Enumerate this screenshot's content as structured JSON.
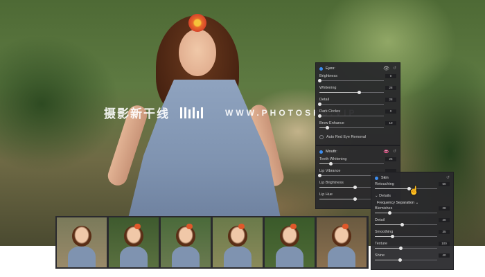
{
  "watermark": {
    "cn_text": "摄影新干线",
    "site": "WWW.PHOTOSKS.VIP"
  },
  "eyes_panel": {
    "title": "Eyes",
    "sliders": [
      {
        "label": "Brightness",
        "value": "0",
        "pct": 0
      },
      {
        "label": "Whitening",
        "value": "28",
        "pct": 0.62
      },
      {
        "label": "Detail",
        "value": "28",
        "pct": 0
      },
      {
        "label": "Dark Circles",
        "value": "0",
        "pct": 0
      },
      {
        "label": "Brow Enhance",
        "value": "10",
        "pct": 0.12
      }
    ],
    "checkbox": "Auto Red Eye Removal"
  },
  "mouth_panel": {
    "title": "Mouth",
    "sliders": [
      {
        "label": "Teeth Whitening",
        "value": "26",
        "pct": 0.18
      },
      {
        "label": "Lip Vibrance",
        "value": "",
        "pct": 0
      },
      {
        "label": "Lip Brightness",
        "value": "",
        "pct": 0.55
      },
      {
        "label": "Lip Hue",
        "value": "",
        "pct": 0.55
      }
    ]
  },
  "skin_panel": {
    "title": "Skin",
    "retouching": {
      "label": "Retouching",
      "value": "50",
      "pct": 0.55
    },
    "details_label": "Details",
    "method": "Frequency Separation",
    "sliders": [
      {
        "label": "Blemishes",
        "value": "28",
        "pct": 0.24
      },
      {
        "label": "Detail",
        "value": "40",
        "pct": 0.44
      },
      {
        "label": "Smoothing",
        "value": "35",
        "pct": 0.28
      },
      {
        "label": "Texture",
        "value": "100",
        "pct": 0.42
      },
      {
        "label": "Shine",
        "value": "40",
        "pct": 0.4
      }
    ]
  },
  "filmstrip": {
    "count": 6,
    "selected_index": 2
  }
}
